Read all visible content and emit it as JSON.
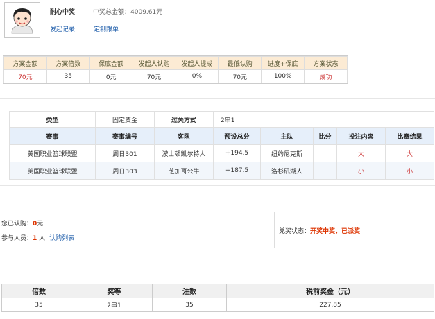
{
  "header": {
    "username": "耐心中奖",
    "prize_total_label": "中奖总金额：",
    "prize_total_value": "4009.61元",
    "link_initiate_record": "发起记录",
    "link_custom_follow": "定制跟单"
  },
  "summary": {
    "headers": [
      "方案金额",
      "方案倍数",
      "保底金额",
      "发起人认购",
      "发起人提成",
      "最低认购",
      "进度+保底",
      "方案状态"
    ],
    "values": [
      "70元",
      "35",
      "0元",
      "70元",
      "0%",
      "70元",
      "100%",
      "成功"
    ]
  },
  "match": {
    "type_label": "类型",
    "type_value": "固定资金",
    "pass_label": "过关方式",
    "pass_value": "2串1",
    "headers": [
      "赛事",
      "赛事编号",
      "客队",
      "预设总分",
      "主队",
      "比分",
      "投注内容",
      "比赛结果"
    ],
    "rows": [
      [
        "美国职业篮球联盟",
        "周日301",
        "波士顿凯尔特人",
        "+194.5",
        "纽约尼克斯",
        "",
        "大",
        "大"
      ],
      [
        "美国职业篮球联盟",
        "周日303",
        "芝加哥公牛",
        "+187.5",
        "洛杉矶湖人",
        "",
        "小",
        "小"
      ]
    ]
  },
  "subscription": {
    "your_sub_label": "您已认购：",
    "your_sub_value": "0",
    "your_sub_unit": "元",
    "participants_label": "参与人员：",
    "participants_value": "1",
    "participants_unit": "人",
    "list_link": "认购列表",
    "award_status_label": "兑奖状态：",
    "award_status_value": "开奖中奖，已派奖"
  },
  "prize_table": {
    "headers": [
      "倍数",
      "奖等",
      "注数",
      "税前奖金（元）"
    ],
    "values": [
      "35",
      "2串1",
      "35",
      "227.85"
    ]
  },
  "colors": {
    "link": "#1a5aa8",
    "highlight_red": "#cc3333",
    "summary_header_bg": "#fcebd4",
    "match_header_bg": "#e6effa"
  }
}
